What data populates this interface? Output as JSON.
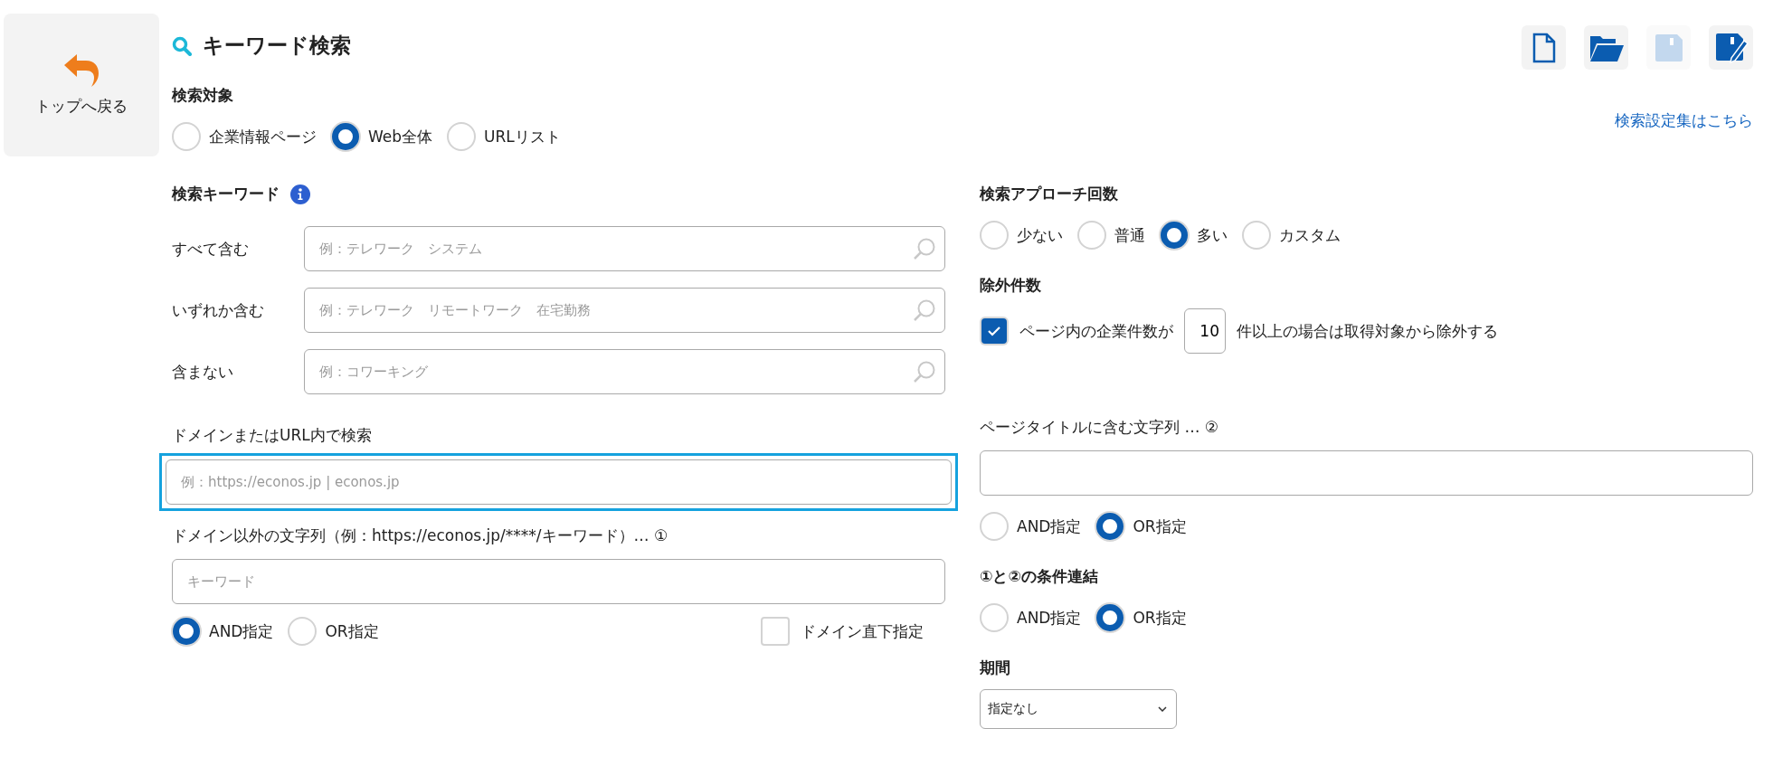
{
  "back_button": {
    "label": "トップへ戻る"
  },
  "title": "キーワード検索",
  "toolbar": [
    {
      "kind": "new",
      "disabled": false
    },
    {
      "kind": "open",
      "disabled": false
    },
    {
      "kind": "save",
      "disabled": true
    },
    {
      "kind": "save_as",
      "disabled": false
    }
  ],
  "search_target": {
    "label": "検索対象",
    "options": [
      {
        "label": "企業情報ページ",
        "selected": false
      },
      {
        "label": "Web全体",
        "selected": true
      },
      {
        "label": "URLリスト",
        "selected": false
      }
    ]
  },
  "settings_link": "検索設定集はこちら",
  "keywords": {
    "label": "検索キーワード",
    "rows": [
      {
        "label": "すべて含む",
        "placeholder": "例：テレワーク　システム"
      },
      {
        "label": "いずれか含む",
        "placeholder": "例：テレワーク　リモートワーク　在宅勤務"
      },
      {
        "label": "含まない",
        "placeholder": "例：コワーキング"
      }
    ]
  },
  "domain_search": {
    "label": "ドメインまたはURL内で検索",
    "placeholder": "例：https://econos.jp | econos.jp",
    "focused": true
  },
  "path_string": {
    "label": "ドメイン以外の文字列（例：https://econos.jp/****/キーワード）… ①",
    "placeholder": "キーワード",
    "options": [
      {
        "label": "AND指定",
        "selected": true
      },
      {
        "label": "OR指定",
        "selected": false
      }
    ],
    "domain_root": {
      "label": "ドメイン直下指定",
      "checked": false
    }
  },
  "approach": {
    "label": "検索アプローチ回数",
    "options": [
      {
        "label": "少ない",
        "selected": false
      },
      {
        "label": "普通",
        "selected": false
      },
      {
        "label": "多い",
        "selected": true
      },
      {
        "label": "カスタム",
        "selected": false
      }
    ]
  },
  "exclusion": {
    "label": "除外件数",
    "checked": true,
    "text_before": "ページ内の企業件数が",
    "value": "10",
    "text_after": "件以上の場合は取得対象から除外する"
  },
  "page_title": {
    "label": "ページタイトルに含む文字列 … ②",
    "options": [
      {
        "label": "AND指定",
        "selected": false
      },
      {
        "label": "OR指定",
        "selected": true
      }
    ]
  },
  "link_condition": {
    "label": "①と②の条件連結",
    "options": [
      {
        "label": "AND指定",
        "selected": false
      },
      {
        "label": "OR指定",
        "selected": true
      }
    ]
  },
  "period": {
    "label": "期間",
    "value": "指定なし"
  }
}
